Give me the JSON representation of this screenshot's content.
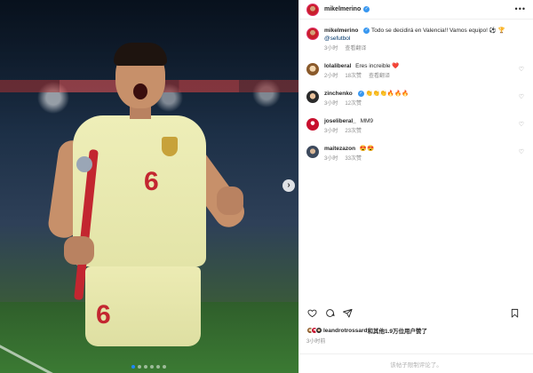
{
  "post": {
    "username": "mikelmerino",
    "more_icon": "more-horizontal-icon",
    "caption_text": "Todo se decidirá en Valencia!! Vamos equipo! ⚽ 🏆",
    "caption_mention": "@sefutbol",
    "caption_time": "3小时",
    "caption_translate": "查看翻译"
  },
  "photo": {
    "jersey_number": "6",
    "shorts_number": "6"
  },
  "comments": [
    {
      "username": "lolaliberal",
      "text": "Eres increible ❤️",
      "time": "2小时",
      "likes": "18次赞",
      "translate": "查看翻译"
    },
    {
      "username": "zinchenko",
      "text": "👏👏👏🔥🔥🔥",
      "time": "3小时",
      "likes": "12次赞",
      "translate": ""
    },
    {
      "username": "joseliberal_",
      "text": "MM9",
      "time": "3小时",
      "likes": "23次赞",
      "translate": ""
    },
    {
      "username": "maitezazon",
      "text": "😍😍",
      "time": "3小时",
      "likes": "33次赞",
      "translate": ""
    }
  ],
  "likes": {
    "liker": "leandrotrossard",
    "text": "和其他1.9万位用户赞了"
  },
  "post_time": "3小时前",
  "footer": "该帖子限制评论了。",
  "colors": {
    "link": "#00376b",
    "verified": "#3897f0",
    "muted": "#8e8e8e"
  }
}
